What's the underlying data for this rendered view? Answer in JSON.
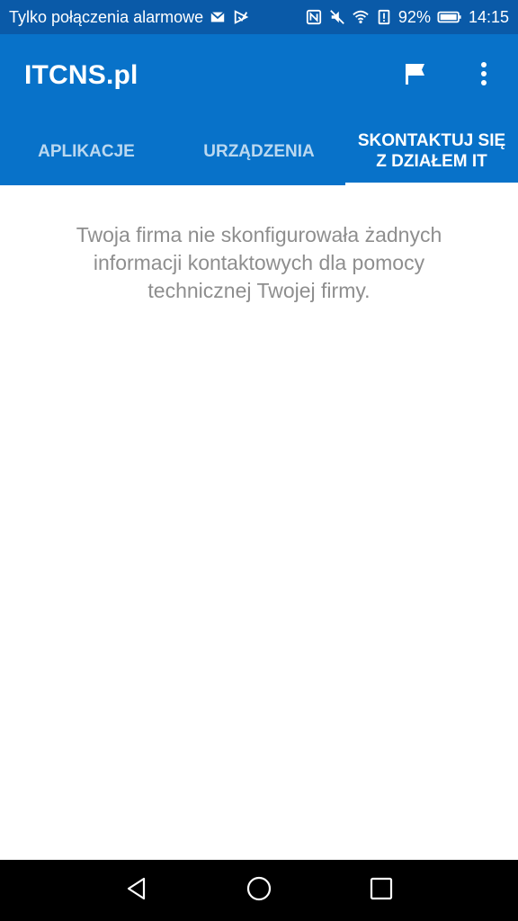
{
  "status_bar": {
    "carrier_text": "Tylko połączenia alarmowe",
    "battery": "92%",
    "time": "14:15",
    "icons": [
      "mail-icon",
      "notification-icon",
      "nfc-icon",
      "mute-icon",
      "wifi-icon",
      "alert-icon",
      "battery-icon"
    ]
  },
  "app_bar": {
    "title": "ITCNS.pl",
    "actions": [
      "flag-icon",
      "more-vert-icon"
    ]
  },
  "tabs": [
    {
      "label": "APLIKACJE",
      "active": false
    },
    {
      "label": "URZĄDZENIA",
      "active": false
    },
    {
      "label": "SKONTAKTUJ SIĘ Z DZIAŁEM IT",
      "active": true
    }
  ],
  "content": {
    "message": "Twoja firma nie skonfigurowała żadnych informacji kontaktowych dla pomocy technicznej Twojej firmy."
  },
  "nav_bar": {
    "buttons": [
      "back-icon",
      "home-icon",
      "recents-icon"
    ]
  },
  "colors": {
    "status_bar": "#0a5aa8",
    "primary": "#0872c9",
    "message_text": "#8e8e8e",
    "nav_bar": "#000000"
  }
}
